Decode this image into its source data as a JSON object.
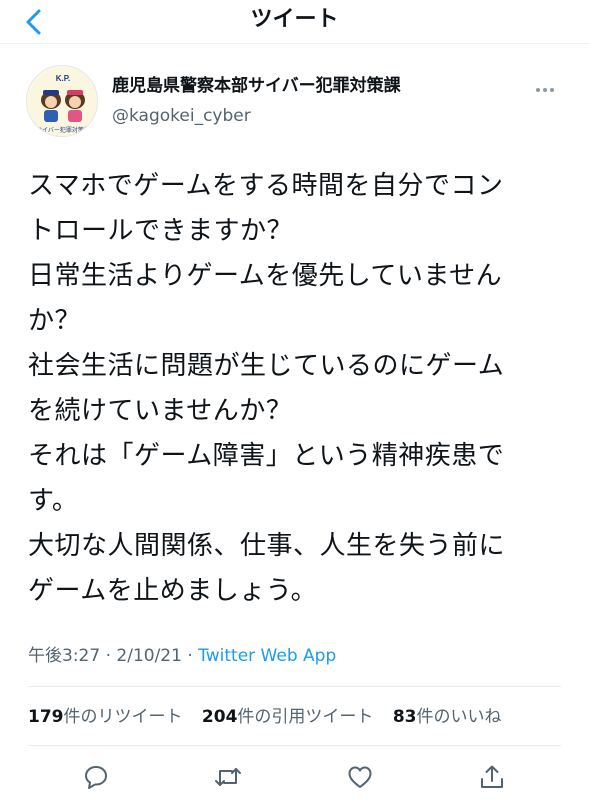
{
  "header": {
    "title": "ツイート"
  },
  "author": {
    "display_name": "鹿児島県警察本部サイバー犯罪対策課",
    "handle": "@kagokei_cyber",
    "avatar_badge": "K.P.",
    "avatar_caption": "サイバー犯罪対策課"
  },
  "tweet": {
    "lines": [
      "スマホでゲームをする時間を自分でコン",
      "トロールできますか？",
      "日常生活よりゲームを優先していません",
      "か？",
      "社会生活に問題が生じているのにゲーム",
      "を続けていませんか？",
      "それは「ゲーム障害」という精神疾患で",
      "す。",
      "大切な人間関係、仕事、人生を失う前に",
      "ゲームを止めましょう。"
    ]
  },
  "meta": {
    "time": "午後3:27",
    "sep1": " · ",
    "date": "2/10/21",
    "sep2": " · ",
    "source": "Twitter Web App"
  },
  "stats": {
    "retweets": {
      "count": "179",
      "label": "件のリツイート"
    },
    "quotes": {
      "count": "204",
      "label": "件の引用ツイート"
    },
    "likes": {
      "count": "83",
      "label": "件のいいね"
    }
  },
  "icons": {
    "back": "chevron-left-icon",
    "more": "more-dots-icon",
    "reply": "reply-icon",
    "retweet": "retweet-icon",
    "like": "heart-icon",
    "share": "share-icon"
  },
  "colors": {
    "accent": "#1d9bf0",
    "secondary_text": "#536471",
    "text": "#0f1419"
  }
}
